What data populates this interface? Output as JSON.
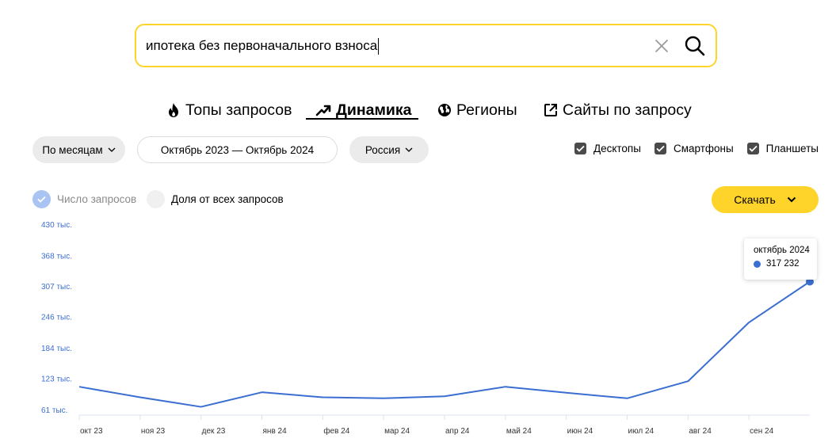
{
  "search": {
    "value": "ипотека без первоначального взноса",
    "clear_icon": "close-icon",
    "search_icon": "search-icon",
    "border_color": "#fed42b"
  },
  "tabs": [
    {
      "label": "Топы запросов",
      "icon": "fire-icon",
      "active": false
    },
    {
      "label": "Динамика",
      "icon": "trend-icon",
      "active": true
    },
    {
      "label": "Регионы",
      "icon": "globe-icon",
      "active": false
    },
    {
      "label": "Сайты по запросу",
      "icon": "external-link-icon",
      "active": false
    }
  ],
  "filters": {
    "period_label": "По месяцам",
    "date_range": "Октябрь 2023 — Октябрь 2024",
    "region": "Россия",
    "devices": [
      {
        "label": "Десктопы",
        "checked": true
      },
      {
        "label": "Смартфоны",
        "checked": true
      },
      {
        "label": "Планшеты",
        "checked": true
      }
    ]
  },
  "metrics": {
    "count_label": "Число запросов",
    "count_selected": true,
    "share_label": "Доля от всех запросов",
    "share_selected": false
  },
  "download_label": "Скачать",
  "tooltip": {
    "date": "октябрь 2024",
    "value": "317 232"
  },
  "colors": {
    "accent": "#fed42b",
    "line": "#3b6ed1",
    "radio_on": "#a9c4f2"
  },
  "chart_data": {
    "type": "line",
    "categories": [
      "окт 23",
      "ноя 23",
      "дек 23",
      "янв 24",
      "фев 24",
      "мар 24",
      "апр 24",
      "май 24",
      "июн 24",
      "июл 24",
      "авг 24",
      "сен 24",
      "окт 24"
    ],
    "x_tick_labels": [
      "окт 23",
      "ноя 23",
      "дек 23",
      "янв 24",
      "фев 24",
      "мар 24",
      "апр 24",
      "май 24",
      "июн 24",
      "июл 24",
      "авг 24",
      "сен 24"
    ],
    "series": [
      {
        "values": [
          108000,
          87000,
          68000,
          97000,
          87000,
          85000,
          89000,
          108000,
          96000,
          85000,
          119000,
          236000,
          317232
        ]
      }
    ],
    "y_ticks": [
      61000,
      123000,
      184000,
      246000,
      307000,
      368000,
      430000
    ],
    "y_tick_labels": [
      "61 тыс.",
      "123 тыс.",
      "184 тыс.",
      "246 тыс.",
      "307 тыс.",
      "368 тыс.",
      "430 тыс."
    ],
    "ylim": [
      45000,
      430000
    ],
    "grid": false,
    "highlight_index": 12
  }
}
